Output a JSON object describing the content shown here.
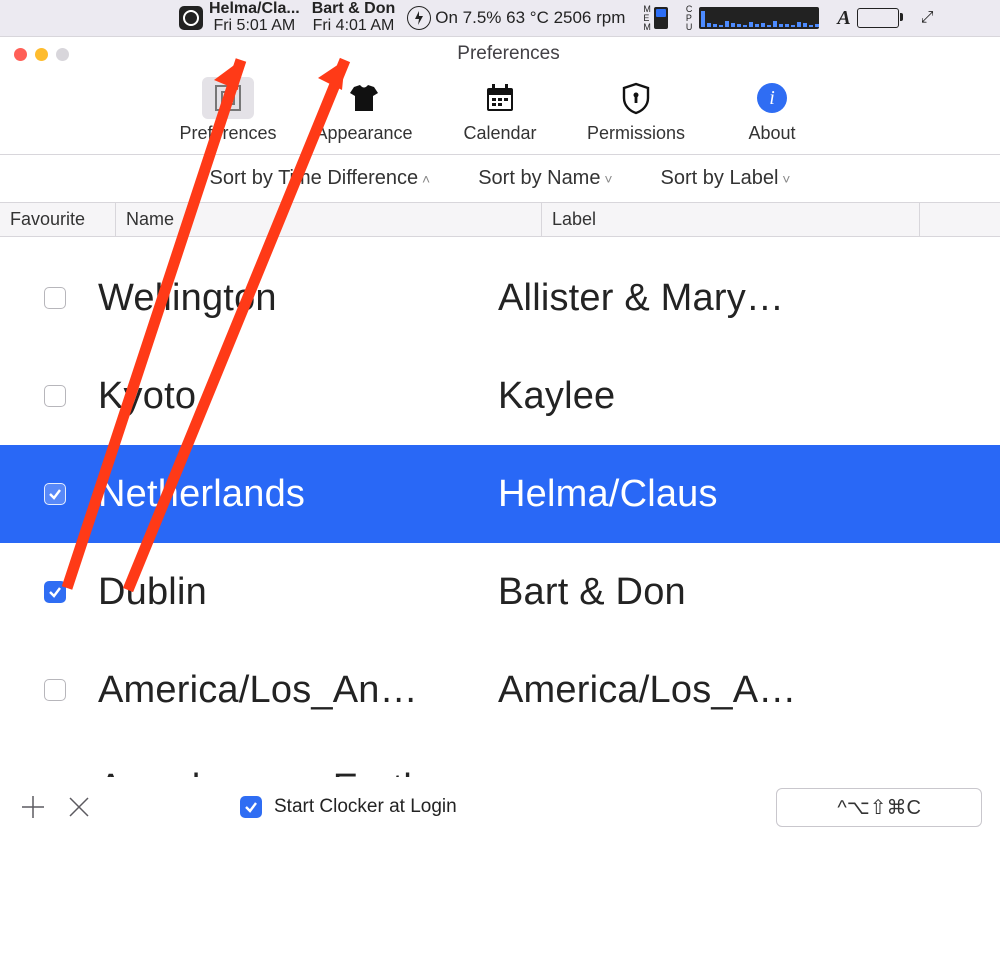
{
  "menubar": {
    "clock1": {
      "label": "Helma/Cla...",
      "time": "Fri 5:01 AM"
    },
    "clock2": {
      "label": "Bart & Don",
      "time": "Fri 4:01 AM"
    },
    "stats": "On 7.5% 63 °C 2506 rpm",
    "mem_tag": "M\nE\nM",
    "cpu_tag": "C\nP\nU"
  },
  "window": {
    "title": "Preferences",
    "tabs": {
      "preferences": "Preferences",
      "appearance": "Appearance",
      "calendar": "Calendar",
      "permissions": "Permissions",
      "about": "About"
    }
  },
  "sort": {
    "diff": "Sort by Time Difference",
    "name": "Sort by Name",
    "label": "Sort by Label"
  },
  "columns": {
    "fav": "Favourite",
    "name": "Name",
    "label": "Label"
  },
  "rows": [
    {
      "fav": false,
      "name": "Wellington",
      "label": "Allister & Mary…",
      "selected": false
    },
    {
      "fav": false,
      "name": "Kyoto",
      "label": "Kaylee",
      "selected": false
    },
    {
      "fav": true,
      "name": "Netherlands",
      "label": "Helma/Claus",
      "selected": true
    },
    {
      "fav": true,
      "name": "Dublin",
      "label": "Bart & Don",
      "selected": false
    },
    {
      "fav": false,
      "name": "America/Los_An…",
      "label": "America/Los_A…",
      "selected": false
    },
    {
      "fav": false,
      "name": "Anywhere on Earth",
      "label": "",
      "selected": false
    }
  ],
  "footer": {
    "login": "Start Clocker at Login",
    "login_checked": true,
    "shortcut": "^⌥⇧⌘C"
  }
}
